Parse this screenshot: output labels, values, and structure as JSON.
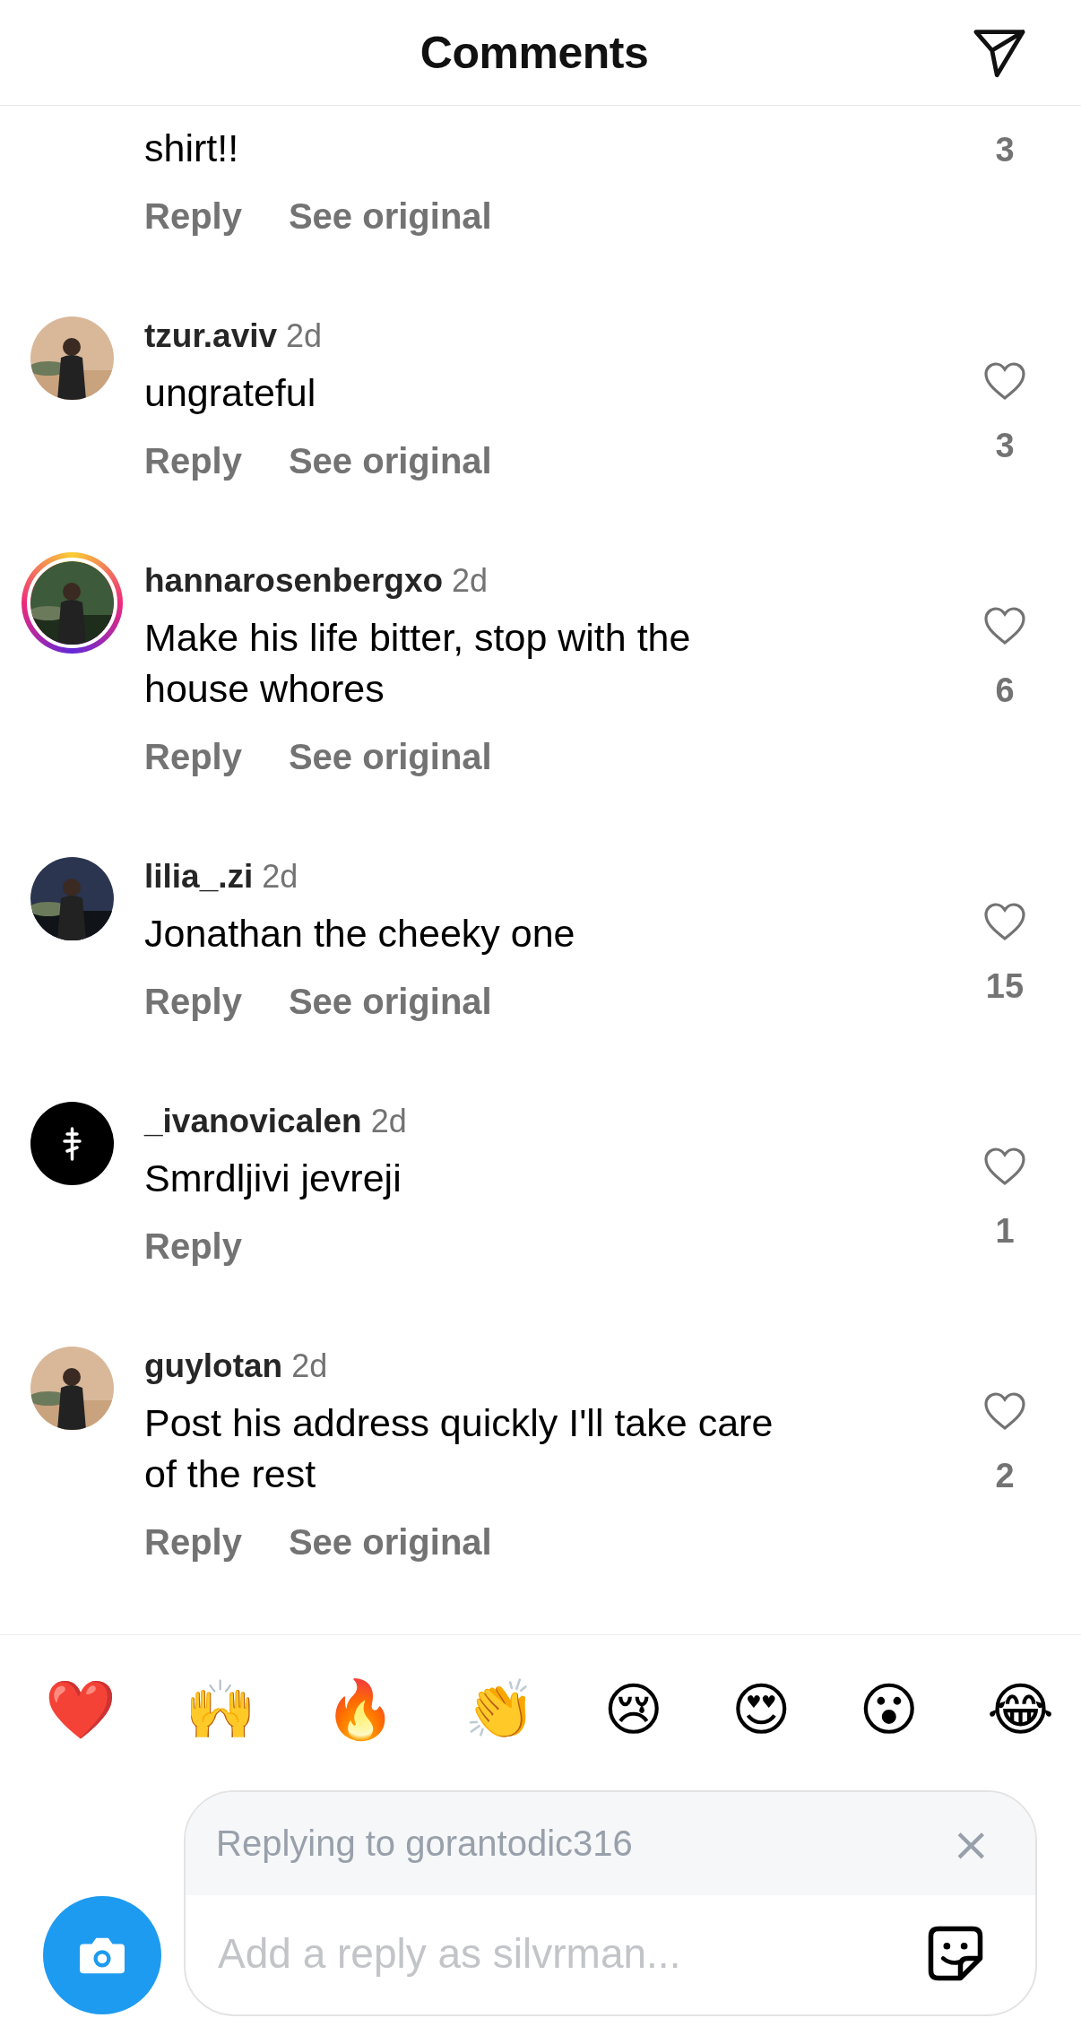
{
  "header": {
    "title": "Comments"
  },
  "comments": [
    {
      "kind": "partial",
      "lines": [
        "shirt!!"
      ],
      "likes": "3",
      "actions": [
        "Reply",
        "See original"
      ]
    },
    {
      "kind": "full",
      "avatar": {
        "kind": "picture"
      },
      "story_ring": false,
      "username": "tzur.aviv",
      "time": "2d",
      "lines": [
        "ungrateful"
      ],
      "liked": false,
      "likes": "3",
      "actions": [
        "Reply",
        "See original"
      ]
    },
    {
      "kind": "full",
      "avatar": {
        "kind": "picture"
      },
      "story_ring": true,
      "username": "hannarosenbergxo",
      "time": "2d",
      "lines": [
        "Make his life bitter, stop with the",
        "house whores"
      ],
      "liked": false,
      "likes": "6",
      "actions": [
        "Reply",
        "See original"
      ]
    },
    {
      "kind": "full",
      "avatar": {
        "kind": "picture"
      },
      "story_ring": false,
      "username": "lilia_.zi",
      "time": "2d",
      "lines": [
        "Jonathan the cheeky one"
      ],
      "liked": false,
      "likes": "15",
      "actions": [
        "Reply",
        "See original"
      ]
    },
    {
      "kind": "full",
      "avatar": {
        "kind": "icon"
      },
      "story_ring": false,
      "username": "_ivanovicalen",
      "time": "2d",
      "lines": [
        "Smrdljivi jevreji"
      ],
      "liked": false,
      "likes": "1",
      "actions": [
        "Reply"
      ]
    },
    {
      "kind": "full",
      "avatar": {
        "kind": "picture"
      },
      "story_ring": false,
      "username": "guylotan",
      "time": "2d",
      "lines": [
        "Post his address quickly I'll take care",
        "of the rest"
      ],
      "liked": false,
      "likes": "2",
      "actions": [
        "Reply",
        "See original"
      ]
    }
  ],
  "reactions": [
    "❤️",
    "🙌",
    "🔥",
    "👏",
    "😢",
    "😍",
    "😮",
    "😂"
  ],
  "composer": {
    "replying_to": "Replying to gorantodic316",
    "close": "×",
    "placeholder": "Add a reply as silvrman..."
  }
}
